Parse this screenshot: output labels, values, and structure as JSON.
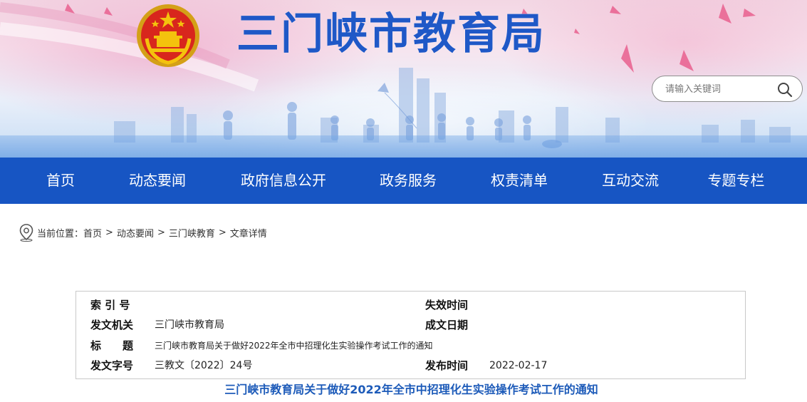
{
  "header": {
    "site_title": "三门峡市教育局",
    "search_placeholder": "请输入关键词",
    "search_icon": "search-icon",
    "emblem_icon": "national-emblem-icon"
  },
  "nav": {
    "items": [
      {
        "label": "首页"
      },
      {
        "label": "动态要闻"
      },
      {
        "label": "政府信息公开"
      },
      {
        "label": "政务服务"
      },
      {
        "label": "权责清单"
      },
      {
        "label": "互动交流"
      },
      {
        "label": "专题专栏"
      }
    ]
  },
  "breadcrumb": {
    "prefix": "当前位置：",
    "items": [
      "首页",
      "动态要闻",
      "三门峡教育",
      "文章详情"
    ],
    "separator": ">"
  },
  "info": {
    "index_label": "索 引 号",
    "index_value": "",
    "expire_label": "失效时间",
    "expire_value": "",
    "issuer_label": "发文机关",
    "issuer_value": "三门峡市教育局",
    "created_label": "成文日期",
    "created_value": "",
    "title_label": "标　　题",
    "title_value": "三门峡市教育局关于做好2022年全市中招理化生实验操作考试工作的通知",
    "doc_no_label": "发文字号",
    "doc_no_value": "三教文〔2022〕24号",
    "publish_label": "发布时间",
    "publish_value": "2022-02-17"
  },
  "article": {
    "title": "三门峡市教育局关于做好2022年全市中招理化生实验操作考试工作的通知"
  },
  "colors": {
    "nav_bg": "#1755c3",
    "title_blue": "#1f58c7",
    "article_title": "#1d5bb9"
  }
}
